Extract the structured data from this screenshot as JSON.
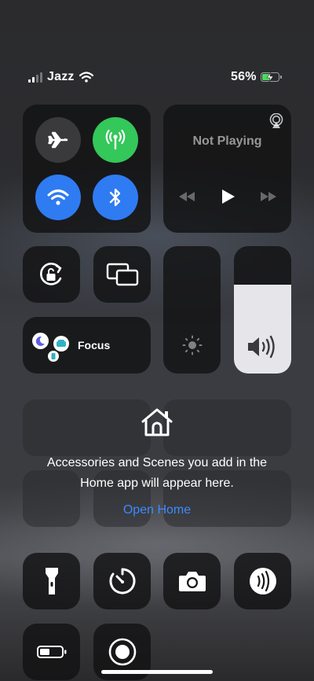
{
  "status": {
    "carrier": "Jazz",
    "battery_percent": "56%",
    "battery_level": 0.56,
    "signal_bars_active": 2,
    "signal_bars_total": 4
  },
  "media": {
    "title": "Not Playing"
  },
  "focus": {
    "label": "Focus"
  },
  "home": {
    "line1": "Accessories and Scenes you add in the",
    "line2": "Home app will appear here.",
    "open_label": "Open Home"
  },
  "sliders": {
    "brightness_level": 0.0,
    "volume_level": 0.7
  },
  "colors": {
    "cellular_active": "#34c759",
    "wifi_active": "#2f7bf2",
    "bluetooth_active": "#2f7bf2",
    "link": "#3d8bff"
  }
}
